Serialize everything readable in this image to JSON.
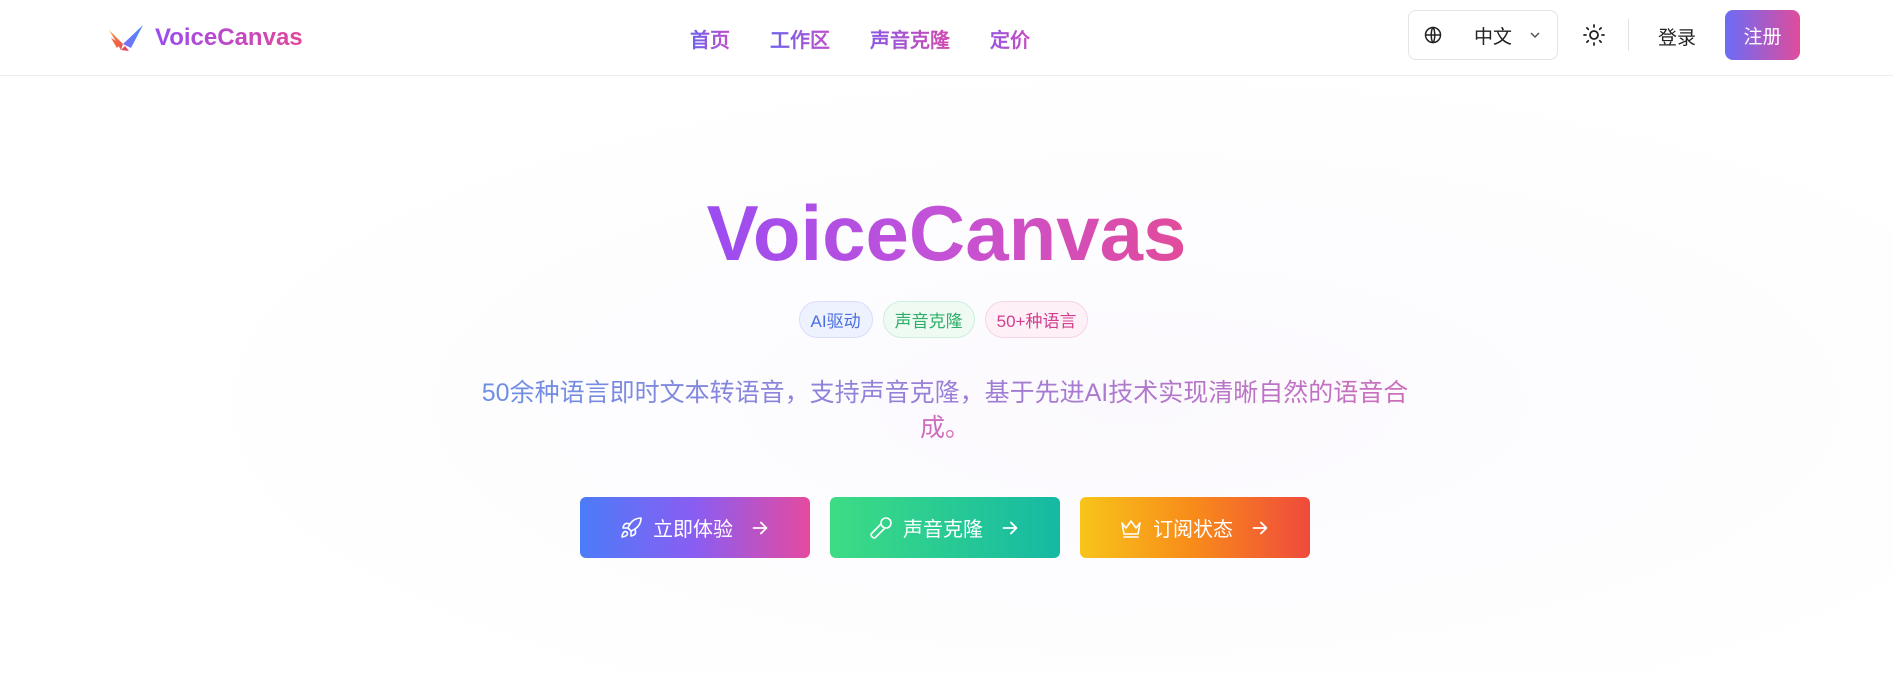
{
  "brand": {
    "name": "VoiceCanvas",
    "logo_icon": "bird-logo-icon"
  },
  "nav": {
    "items": [
      {
        "label": "首页"
      },
      {
        "label": "工作区"
      },
      {
        "label": "声音克隆"
      },
      {
        "label": "定价"
      }
    ]
  },
  "header": {
    "language": {
      "selected": "中文",
      "icon": "globe-icon"
    },
    "theme_icon": "sun-icon",
    "login_label": "登录",
    "register_label": "注册"
  },
  "hero": {
    "title": "VoiceCanvas",
    "badges": [
      "AI驱动",
      "声音克隆",
      "50+种语言"
    ],
    "subtitle": "50余种语言即时文本转语音，支持声音克隆，基于先进AI技术实现清晰自然的语音合成。",
    "actions": [
      {
        "label": "立即体验",
        "icon": "rocket-icon",
        "color_from": "#4b7cf8",
        "color_to": "#e54a9f"
      },
      {
        "label": "声音克隆",
        "icon": "microphone-icon",
        "color_from": "#3ddc84",
        "color_to": "#15b9a3"
      },
      {
        "label": "订阅状态",
        "icon": "crown-icon",
        "color_from": "#f8c41a",
        "color_to": "#ef4a3d"
      }
    ]
  },
  "colors": {
    "brand_gradient_start": "#9a4cf0",
    "brand_gradient_end": "#e1479b"
  }
}
